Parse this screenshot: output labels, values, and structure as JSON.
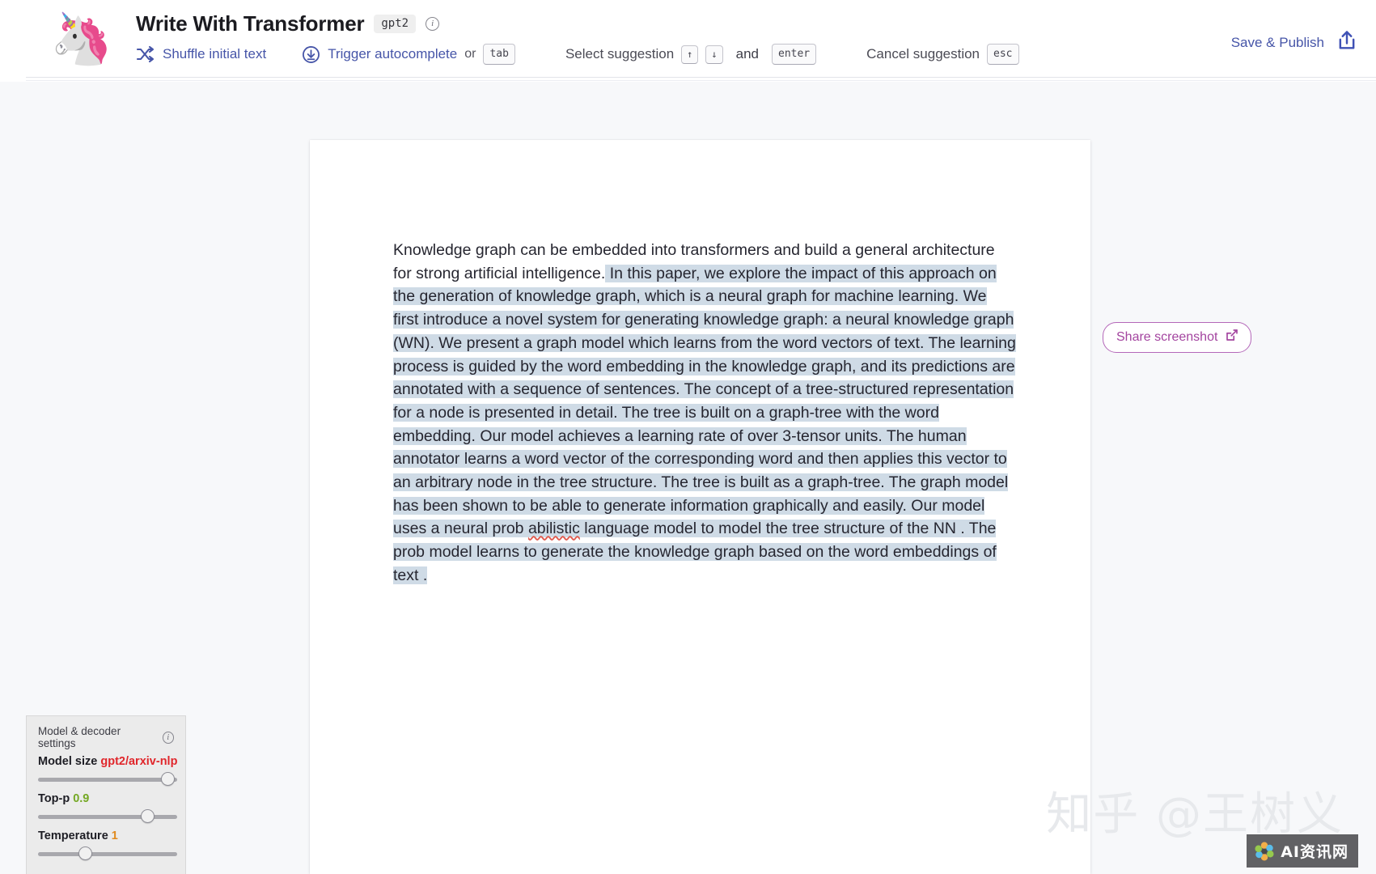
{
  "header": {
    "logo_emoji": "🦄",
    "title": "Write With Transformer",
    "model_badge": "gpt2",
    "info_glyph": "i",
    "hints": {
      "shuffle_label": "Shuffle initial text",
      "trigger_label": "Trigger autocomplete",
      "or_word": "or",
      "tab_key": "tab",
      "select_label": "Select suggestion",
      "arrow_up_key": "↑",
      "arrow_down_key": "↓",
      "and_word": "and",
      "enter_key": "enter",
      "cancel_label": "Cancel suggestion",
      "esc_key": "esc"
    },
    "save_publish_label": "Save & Publish"
  },
  "main": {
    "share_button_label": "Share screenshot",
    "document": {
      "seed_text": "Knowledge graph can be embedded into transformers and build a general architecture for strong artificial intelligence.",
      "generated_text_part1": " In this paper, we explore the impact of this approach on the generation of knowledge graph, which is a neural graph for machine learning. We first introduce a novel system for generating knowledge graph: a neural knowledge graph (WN).  We present a graph model which learns from the word vectors of text. The learning process is guided by the word embedding in the knowledge graph, and its predictions are annotated with  a sequence of sentences. The concept of a tree-structured representation for a node is presented in detail. The tree is built on a graph-tree with the word embedding. Our model achieves a learning rate of over 3-tensor units. The human annotator learns a word vector of the corresponding  word and then applies this vector to an arbitrary node in the tree structure. The tree is built as a graph-tree. The graph model has been shown to be able to generate information graphically and easily. Our model uses a neural prob ",
      "misspelled_word": "abilistic",
      "generated_text_part2": " language model to model the tree structure of the NN . The prob model learns  to generate the knowledge graph based on the word embeddings of text ."
    }
  },
  "settings": {
    "panel_title": "Model & decoder settings",
    "info_glyph": "i",
    "model_size": {
      "label": "Model size",
      "value": "gpt2/arxiv-nlp",
      "slider_percent": 98
    },
    "top_p": {
      "label": "Top-p",
      "value": "0.9",
      "slider_percent": 82
    },
    "temperature": {
      "label": "Temperature",
      "value": "1",
      "slider_percent": 32
    }
  },
  "watermarks": {
    "zhihu_text": "知乎 @王树义",
    "ai_badge_text": "AI资讯网"
  },
  "colors": {
    "accent_blue": "#4655a8",
    "highlight": "#cfdbe6",
    "purple": "#a3449f",
    "model_red": "#e0262b",
    "topp_green": "#74a823",
    "temp_orange": "#e08a1e",
    "canvas_bg": "#f7f8fa"
  }
}
